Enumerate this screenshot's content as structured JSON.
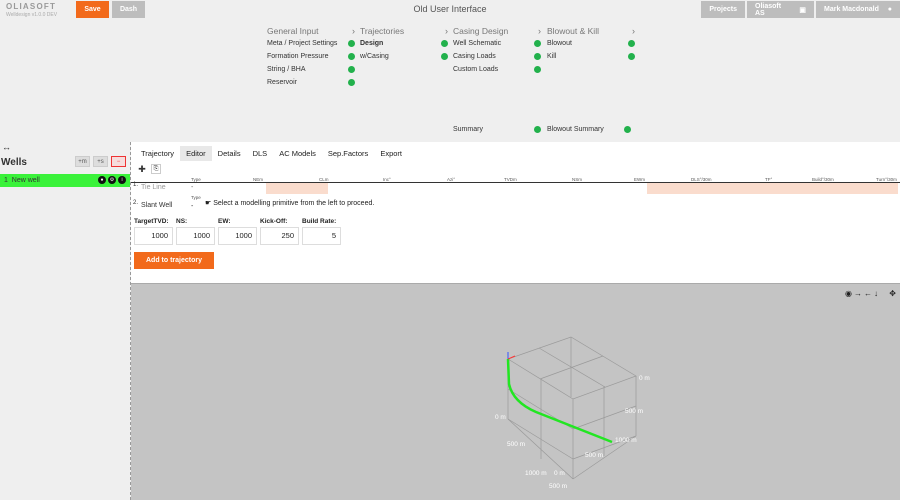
{
  "header": {
    "logo": "OLIASOFT",
    "logo_sub": "Welldesign v1.0.0 DEV",
    "save_label": "Save",
    "dash_label": "Dash",
    "title": "Old User Interface",
    "projects_label": "Projects",
    "company_label": "Oliasoft AS",
    "user_label": "Mark Macdonald"
  },
  "workflow": {
    "general_input": {
      "title": "General Input",
      "items": [
        "Meta / Project Settings",
        "Formation Pressure",
        "String / BHA",
        "Reservoir"
      ]
    },
    "trajectories": {
      "title": "Trajectories",
      "items": [
        "Design",
        "w/Casing"
      ]
    },
    "casing_design": {
      "title": "Casing Design",
      "items": [
        "Well Schematic",
        "Casing Loads",
        "Custom Loads"
      ],
      "summary": "Summary"
    },
    "blowout_kill": {
      "title": "Blowout & Kill",
      "items": [
        "Blowout",
        "Kill"
      ],
      "summary": "Blowout Summary"
    }
  },
  "wells": {
    "title": "Wells",
    "add_label": "+m",
    "add_s_label": "+s",
    "remove_label": "−",
    "items": [
      {
        "index": "1",
        "name": "New well"
      }
    ]
  },
  "tabs": [
    "Trajectory",
    "Editor",
    "Details",
    "DLS",
    "AC Models",
    "Sep.Factors",
    "Export"
  ],
  "active_tab": "Editor",
  "grid": {
    "columns": [
      "Type",
      "NEm",
      "CLm",
      "Inc°",
      "Azi°",
      "TVDm",
      "NSm",
      "EWm",
      "DLS°/30m",
      "TF°",
      "Build°/30m",
      "Turn°/30m"
    ],
    "rows": [
      {
        "num": "1.",
        "label": "Tie Line",
        "type": "-"
      },
      {
        "num": "2.",
        "label": "Slant Well",
        "type_label": "Type",
        "type": "-"
      }
    ],
    "hint": "Select a modelling primitive from the left to proceed."
  },
  "params": [
    {
      "label": "TargetTVD:",
      "value": "1000"
    },
    {
      "label": "NS:",
      "value": "1000"
    },
    {
      "label": "EW:",
      "value": "1000"
    },
    {
      "label": "Kick-Off:",
      "value": "250"
    },
    {
      "label": "Build Rate:",
      "value": "5"
    }
  ],
  "add_button": "Add to trajectory",
  "view3d": {
    "axis_labels": [
      "0 m",
      "500 m",
      "1000 m",
      "0 m",
      "500 m",
      "500 m",
      "1000 m",
      "0 m",
      "500 m"
    ],
    "trajectory_color": "#22e622",
    "accent": "#f26a1b"
  }
}
